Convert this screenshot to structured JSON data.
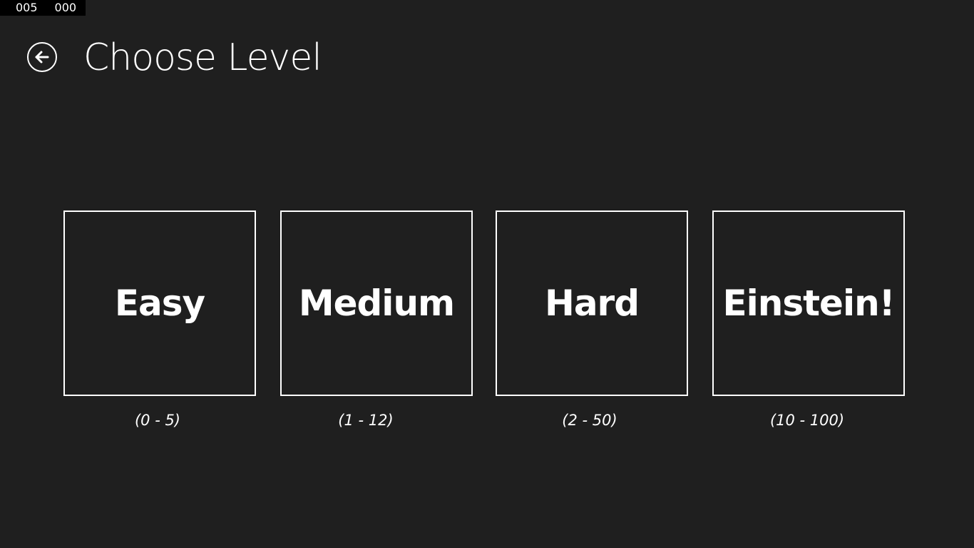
{
  "debug": {
    "counter_1": "005",
    "counter_2": "000"
  },
  "header": {
    "back_icon": "arrow-left-circle-icon",
    "title": "Choose Level"
  },
  "levels": [
    {
      "label": "Easy",
      "range": "(0 - 5)"
    },
    {
      "label": "Medium",
      "range": "(1 - 12)"
    },
    {
      "label": "Hard",
      "range": "(2 - 50)"
    },
    {
      "label": "Einstein!",
      "range": "(10 - 100)"
    }
  ],
  "colors": {
    "background": "#1f1f1f",
    "foreground": "#ffffff",
    "debug_bar": "#000000"
  }
}
